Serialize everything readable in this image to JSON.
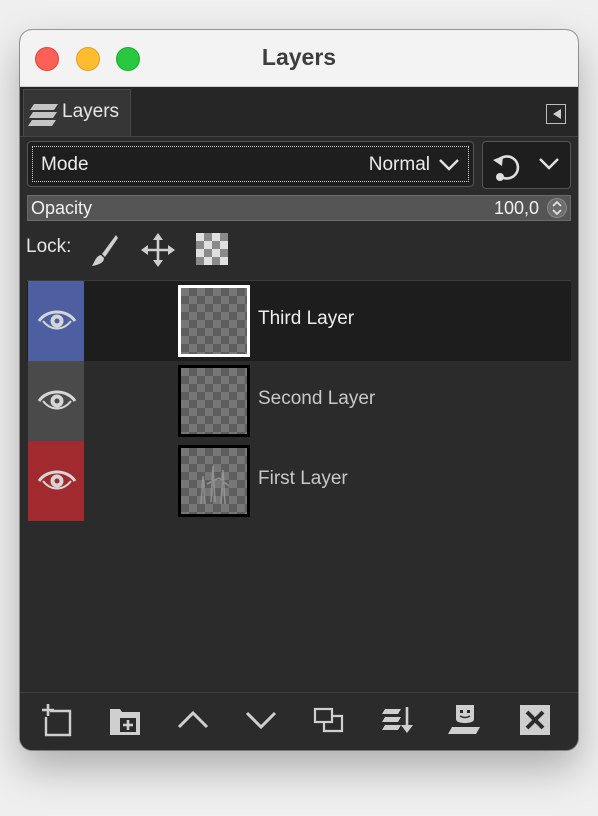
{
  "window": {
    "title": "Layers"
  },
  "tab": {
    "label": "Layers"
  },
  "mode": {
    "label": "Mode",
    "value": "Normal"
  },
  "opacity": {
    "label": "Opacity",
    "value": "100,0"
  },
  "lock": {
    "label": "Lock:",
    "icons": [
      "lock-pixels-icon",
      "lock-position-icon",
      "lock-alpha-icon"
    ]
  },
  "layers": [
    {
      "name": "Third Layer",
      "selected": true,
      "visible": true,
      "tag_color": "#4d5fa0"
    },
    {
      "name": "Second Layer",
      "selected": false,
      "visible": true,
      "tag_color": "#4a4a4a"
    },
    {
      "name": "First Layer",
      "selected": false,
      "visible": true,
      "tag_color": "#a02a2e"
    }
  ],
  "toolbar": {
    "icons": [
      "new-layer-icon",
      "new-layer-group-icon",
      "raise-layer-icon",
      "lower-layer-icon",
      "duplicate-layer-icon",
      "merge-down-icon",
      "add-mask-icon",
      "delete-layer-icon"
    ]
  },
  "colors": {
    "panel_bg": "#2b2b2b",
    "selected_row": "#1d1d1d",
    "opacity_bar": "#555555"
  }
}
